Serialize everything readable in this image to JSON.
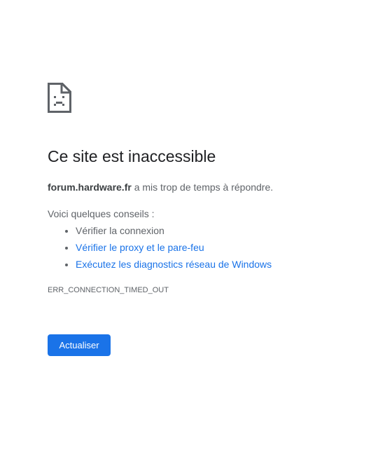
{
  "page": {
    "icon": "sad-page-icon",
    "title": "Ce site est inaccessible",
    "summary": {
      "host": "forum.hardware.fr",
      "message": " a mis trop de temps à répondre."
    },
    "tips_intro": "Voici quelques conseils :",
    "tips": [
      {
        "label": "Vérifier la connexion",
        "is_link": false
      },
      {
        "label": "Vérifier le proxy et le pare-feu",
        "is_link": true
      },
      {
        "label": "Exécutez les diagnostics réseau de Windows",
        "is_link": true
      }
    ],
    "error_code": "ERR_CONNECTION_TIMED_OUT",
    "reload_label": "Actualiser"
  },
  "colors": {
    "accent": "#1a73e8",
    "heading": "#202124",
    "body_text": "#5f6368"
  }
}
